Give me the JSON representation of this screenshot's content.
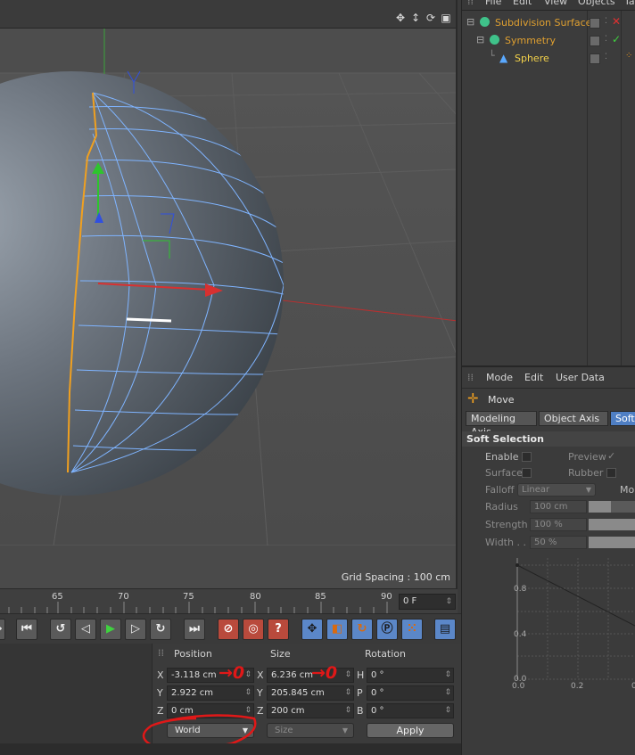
{
  "viewport": {
    "grid_spacing": "Grid Spacing : 100 cm",
    "nav_icons": [
      "move-view-icon",
      "zoom-view-icon",
      "rotate-view-icon",
      "maximize-view-icon"
    ]
  },
  "timeline": {
    "ticks": [
      "65",
      "70",
      "75",
      "80",
      "85",
      "90"
    ],
    "current_frame": "0 F"
  },
  "transport": {
    "buttons": [
      {
        "name": "goto-start-button",
        "glyph": "⏮"
      },
      {
        "name": "prev-key-button",
        "glyph": "↺"
      },
      {
        "name": "prev-frame-button",
        "glyph": "◁"
      },
      {
        "name": "play-button",
        "glyph": "▶"
      },
      {
        "name": "next-frame-button",
        "glyph": "▷"
      },
      {
        "name": "next-key-button",
        "glyph": "↻"
      },
      {
        "name": "goto-end-button",
        "glyph": "⏭"
      }
    ]
  },
  "coords": {
    "headers": {
      "position": "Position",
      "size": "Size",
      "rotation": "Rotation"
    },
    "position": [
      {
        "axis": "X",
        "value": "-3.118 cm"
      },
      {
        "axis": "Y",
        "value": "2.922 cm"
      },
      {
        "axis": "Z",
        "value": "0 cm"
      }
    ],
    "size": [
      {
        "axis": "X",
        "value": "6.236 cm"
      },
      {
        "axis": "Y",
        "value": "205.845 cm"
      },
      {
        "axis": "Z",
        "value": "200 cm"
      }
    ],
    "rotation": [
      {
        "axis": "H",
        "value": "0 °"
      },
      {
        "axis": "P",
        "value": "0 °"
      },
      {
        "axis": "B",
        "value": "0 °"
      }
    ],
    "mode_select": "World",
    "size_select": "Size",
    "apply": "Apply",
    "annotations": [
      "→0",
      "→0"
    ]
  },
  "object_manager": {
    "menu": [
      "File",
      "Edit",
      "View",
      "Objects",
      "Ta"
    ],
    "objects": [
      {
        "name": "Subdivision Surface",
        "color": "#e0a030",
        "indent": 0
      },
      {
        "name": "Symmetry",
        "color": "#e0a030",
        "indent": 1
      },
      {
        "name": "Sphere",
        "color": "#f3d24a",
        "indent": 2
      }
    ]
  },
  "attribute_manager": {
    "menu": [
      "Mode",
      "Edit",
      "User Data"
    ],
    "tool_name": "Move",
    "tabs": [
      "Modeling Axis",
      "Object Axis",
      "Soft"
    ],
    "section": "Soft Selection",
    "enable": "Enable",
    "preview": "Preview",
    "surface": "Surface",
    "rubber": "Rubber",
    "falloff": "Falloff",
    "falloff_value": "Linear",
    "mode_label": "Mo",
    "radius": "Radius",
    "radius_value": "100 cm",
    "strength": "Strength",
    "strength_value": "100 %",
    "width": "Width . .",
    "width_value": "50 %",
    "graph_y_labels": [
      "0.8",
      "0.4",
      "0.0"
    ],
    "graph_x_labels": [
      "0.0",
      "0.2",
      "0"
    ]
  },
  "colors": {
    "selection_edge": "#f0a020",
    "mesh_wire": "#7fb4ff",
    "accent_blue": "#4f7fc4",
    "annotation_red": "#e01818"
  }
}
